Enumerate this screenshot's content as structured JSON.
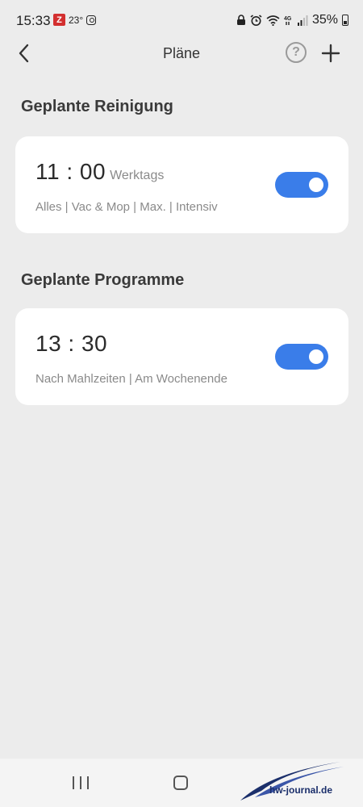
{
  "status_bar": {
    "time": "15:33",
    "app_badge": "Z",
    "temperature": "23°",
    "battery": "35%"
  },
  "header": {
    "title": "Pläne",
    "help_label": "?"
  },
  "sections": {
    "cleaning": {
      "title": "Geplante Reinigung",
      "time": "11 : 00",
      "days": "Werktags",
      "description": "Alles | Vac & Mop | Max. | Intensiv",
      "enabled": true
    },
    "programs": {
      "title": "Geplante Programme",
      "time": "13 : 30",
      "description": "Nach Mahlzeiten | Am Wochenende",
      "enabled": true
    }
  },
  "watermark": {
    "text": "hw-journal.de"
  },
  "colors": {
    "accent": "#3a7de9",
    "background": "#ececec",
    "card": "#ffffff"
  }
}
